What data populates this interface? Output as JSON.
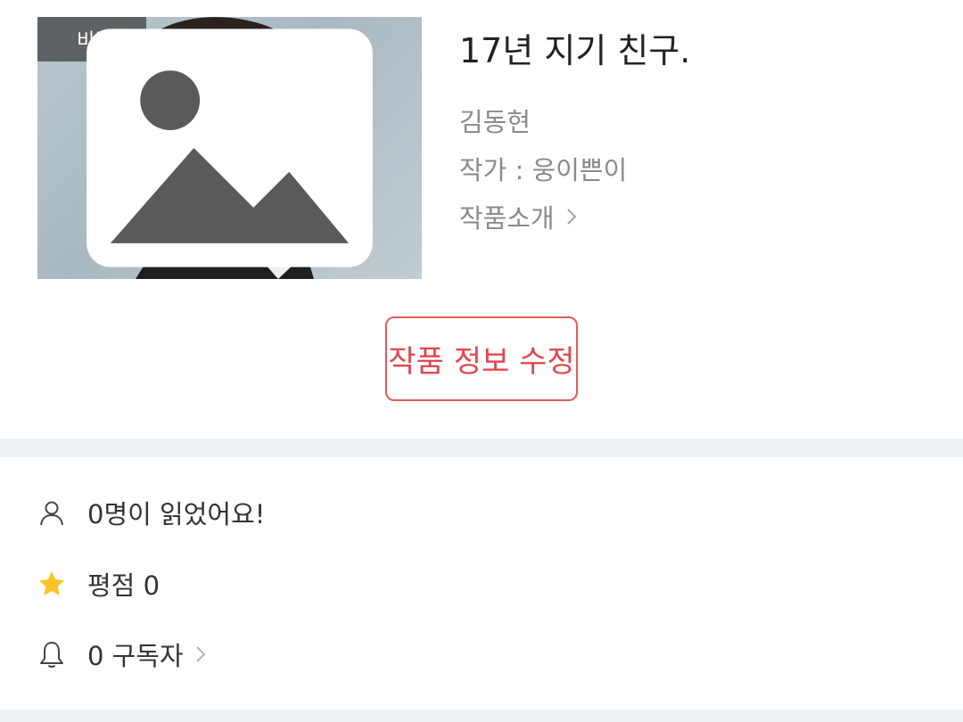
{
  "work": {
    "cover_badge": "비주얼",
    "title": "17년 지기 친구.",
    "author": "김동현",
    "writer": "작가 : 웅이쁜이",
    "intro_link": "작품소개"
  },
  "actions": {
    "edit_label": "작품 정보 수정"
  },
  "stats": {
    "readers": "0명이 읽었어요!",
    "rating": "평점 0",
    "subscribers": "0 구독자"
  },
  "colors": {
    "accent": "#e0484f",
    "star": "#f7c52b",
    "divider": "#eef2f4"
  },
  "icons": [
    "image-icon",
    "chevron-right-icon",
    "person-icon",
    "star-icon",
    "bell-icon"
  ]
}
